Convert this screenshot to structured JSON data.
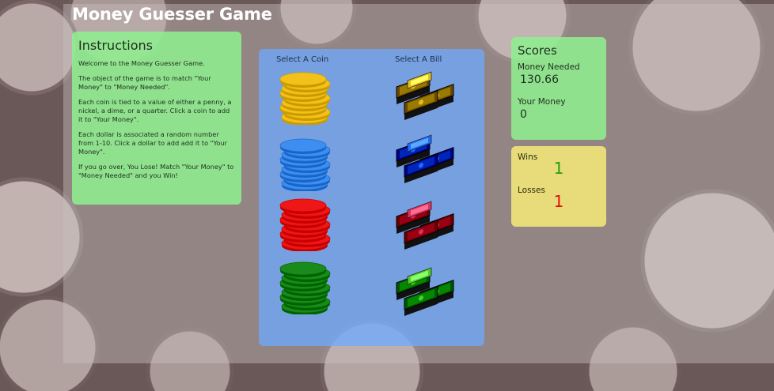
{
  "title": "Money Guesser Game",
  "instructions": {
    "heading": "Instructions",
    "paragraphs": [
      "Welcome to the Money Guesser Game.",
      "The object of the game is to match \"Your Money\" to \"Money Needed\".",
      "Each coin is tied to a value of either a penny, a nickel, a dime, or a quarter. Click a coin to add it to \"Your Money\".",
      "Each dollar is associated a random number from 1-10. Click a dollar to add add it to \"Your Money\".",
      "If you go over, You Lose! Match \"Your Money\" to \"Money Needed\" and you Win!"
    ]
  },
  "picker": {
    "coin_header": "Select A Coin",
    "bill_header": "Select A Bill",
    "coins": [
      {
        "name": "yellow-coin-stack",
        "color": "#f2c21a"
      },
      {
        "name": "blue-coin-stack",
        "color": "#3d8ef0"
      },
      {
        "name": "red-coin-stack",
        "color": "#ee1616"
      },
      {
        "name": "green-coin-stack",
        "color": "#1a8a1a"
      }
    ],
    "bills": [
      {
        "name": "yellow-bill-stack",
        "color": "#e0c020"
      },
      {
        "name": "blue-bill-stack",
        "color": "#1e6cff"
      },
      {
        "name": "red-bill-stack",
        "color": "#e0305a"
      },
      {
        "name": "green-bill-stack",
        "color": "#4ccd2a"
      }
    ]
  },
  "scores": {
    "heading": "Scores",
    "money_needed_label": "Money Needed",
    "money_needed": "130.66",
    "your_money_label": "Your Money",
    "your_money": "0"
  },
  "record": {
    "wins_label": "Wins",
    "wins": "1",
    "wins_color": "#2a9a10",
    "losses_label": "Losses",
    "losses": "1",
    "losses_color": "#e01010"
  }
}
